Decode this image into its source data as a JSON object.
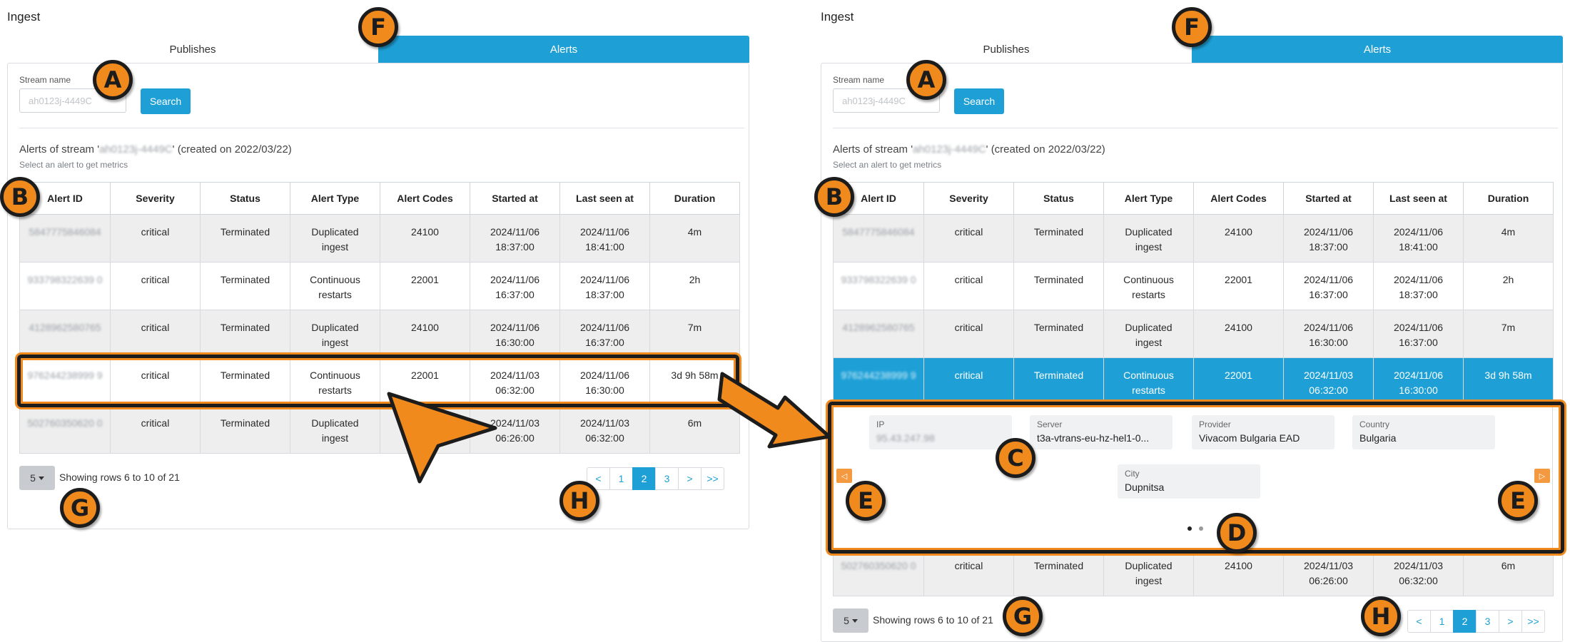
{
  "colors": {
    "accent": "#1ea0d6",
    "annotation_fill": "#f08a1c",
    "annotation_stroke": "#1c1c1c",
    "carousel_arrow": "#f39a40"
  },
  "page": {
    "title": "Ingest"
  },
  "tabs": {
    "publishes": "Publishes",
    "alerts": "Alerts",
    "active": "alerts"
  },
  "search": {
    "label": "Stream name",
    "value": "ah0123j-4449C",
    "button": "Search"
  },
  "alerts_header": {
    "prefix": "Alerts of stream '",
    "stream": "ah0123j-4449C",
    "suffix": "' (created on 2022/03/22)",
    "subtitle": "Select an alert to get metrics"
  },
  "table": {
    "columns": [
      "Alert ID",
      "Severity",
      "Status",
      "Alert Type",
      "Alert Codes",
      "Started at",
      "Last seen at",
      "Duration"
    ],
    "rows": [
      {
        "id": "5847775846084",
        "severity": "critical",
        "status": "Terminated",
        "type_l1": "Duplicated",
        "type_l2": "ingest",
        "code": "24100",
        "start_l1": "2024/11/06",
        "start_l2": "18:37:00",
        "last_l1": "2024/11/06",
        "last_l2": "18:41:00",
        "duration": "4m"
      },
      {
        "id": "933798322639 0",
        "severity": "critical",
        "status": "Terminated",
        "type_l1": "Continuous",
        "type_l2": "restarts",
        "code": "22001",
        "start_l1": "2024/11/06",
        "start_l2": "16:37:00",
        "last_l1": "2024/11/06",
        "last_l2": "18:37:00",
        "duration": "2h"
      },
      {
        "id": "4128962580765",
        "severity": "critical",
        "status": "Terminated",
        "type_l1": "Duplicated",
        "type_l2": "ingest",
        "code": "24100",
        "start_l1": "2024/11/06",
        "start_l2": "16:30:00",
        "last_l1": "2024/11/06",
        "last_l2": "16:37:00",
        "duration": "7m"
      },
      {
        "id": "976244238999 9",
        "severity": "critical",
        "status": "Terminated",
        "type_l1": "Continuous",
        "type_l2": "restarts",
        "code": "22001",
        "start_l1": "2024/11/03",
        "start_l2": "06:32:00",
        "last_l1": "2024/11/06",
        "last_l2": "16:30:00",
        "duration": "3d 9h 58m"
      },
      {
        "id": "502760350620 0",
        "severity": "critical",
        "status": "Terminated",
        "type_l1": "Duplicated",
        "type_l2": "ingest",
        "code": "24100",
        "start_l1": "2024/11/03",
        "start_l2": "06:26:00",
        "last_l1": "2024/11/03",
        "last_l2": "06:32:00",
        "duration": "6m"
      }
    ]
  },
  "details": {
    "ip_label": "IP",
    "ip_value": "95.43.247.98",
    "server_label": "Server",
    "server_value": "t3a-vtrans-eu-hz-hel1-0...",
    "provider_label": "Provider",
    "provider_value": "Vivacom Bulgaria EAD",
    "country_label": "Country",
    "country_value": "Bulgaria",
    "city_label": "City",
    "city_value": "Dupnitsa",
    "prev_arrow": "◁",
    "next_arrow": "▷"
  },
  "pager": {
    "page_size": "5",
    "rows_text": "Showing rows 6 to 10 of 21",
    "pages": [
      "<",
      "1",
      "2",
      "3",
      ">",
      ">>"
    ],
    "current_page": "2"
  },
  "annotations": {
    "a": "A",
    "b": "B",
    "c": "C",
    "d": "D",
    "e": "E",
    "f": "F",
    "g": "G",
    "h": "H"
  }
}
